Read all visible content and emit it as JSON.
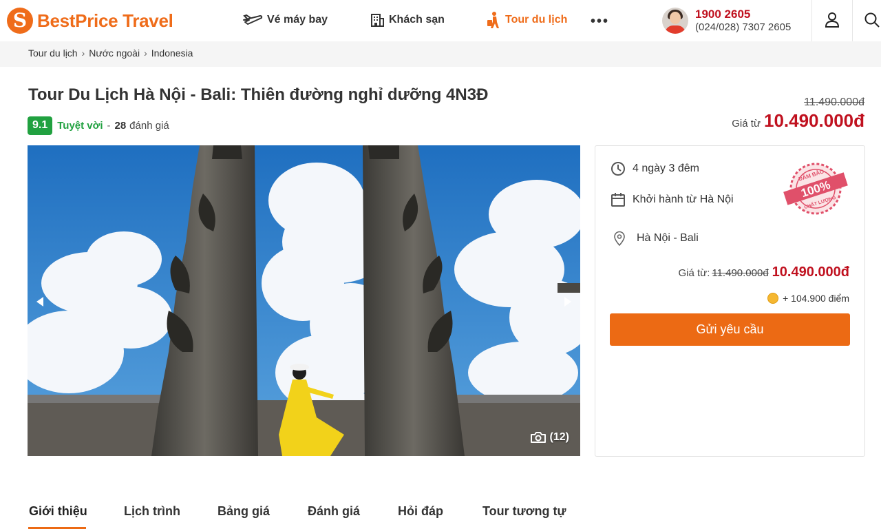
{
  "brand": {
    "name": "BestPrice Travel",
    "logo_letter": "S",
    "accent": "#ef6c1a"
  },
  "nav": {
    "items": [
      {
        "label": "Vé máy bay",
        "icon": "plane-icon"
      },
      {
        "label": "Khách sạn",
        "icon": "hotel-icon"
      },
      {
        "label": "Tour du lịch",
        "icon": "traveler-icon",
        "active": true
      }
    ],
    "more_label": "•••"
  },
  "contact": {
    "hotline": "1900 2605",
    "phone": "(024/028) 7307 2605"
  },
  "breadcrumb": [
    "Tour du lịch",
    "Nước ngoài",
    "Indonesia"
  ],
  "breadcrumb_separator": "›",
  "tour": {
    "title": "Tour Du Lịch Hà Nội - Bali: Thiên đường nghỉ dưỡng 4N3Đ",
    "score": "9.1",
    "rating_word": "Tuyệt vời",
    "rating_dash": "-",
    "reviews_count": "28",
    "reviews_label": "đánh giá",
    "old_price": "11.490.000đ",
    "from_label": "Giá từ",
    "price": "10.490.000đ"
  },
  "gallery": {
    "photo_count": "(12)"
  },
  "card": {
    "duration": "4 ngày 3 đêm",
    "departure": "Khởi hành từ Hà Nội",
    "route": "Hà Nội - Bali",
    "from_label": "Giá từ:",
    "old_price": "11.490.000đ",
    "price": "10.490.000đ",
    "points": "+ 104.900 điểm",
    "button_label": "Gửi yêu cầu",
    "stamp": {
      "top_text": "ĐẢM BẢO",
      "center_text": "100%",
      "bottom_text": "CHẤT LƯỢNG"
    }
  },
  "tabs": [
    "Giới thiệu",
    "Lịch trình",
    "Bảng giá",
    "Đánh giá",
    "Hỏi đáp",
    "Tour tương tự"
  ],
  "colors": {
    "price_red": "#c0111f",
    "rating_green": "#21a140",
    "button_orange": "#ec6a14"
  }
}
